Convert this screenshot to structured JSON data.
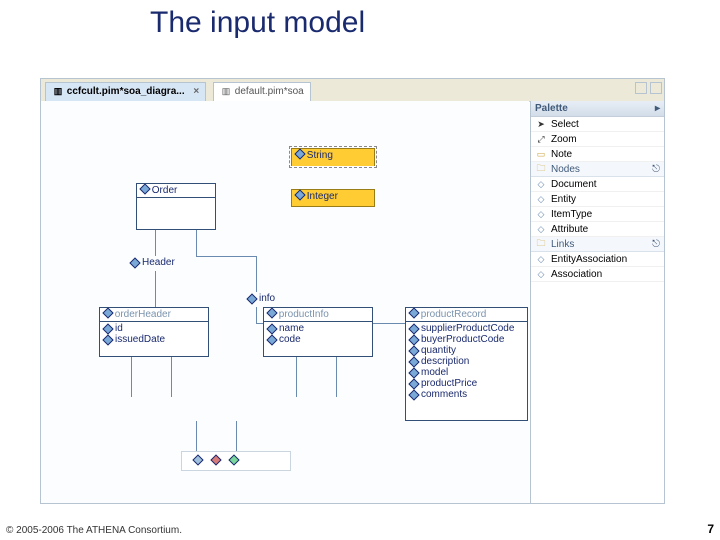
{
  "title": "The input model",
  "footer": "© 2005-2006 The ATHENA Consortium.",
  "page_number": "7",
  "tabs": {
    "active": "ccfcult.pim*soa_diagra...",
    "inactive": "default.pim*soa"
  },
  "palette": {
    "title": "Palette",
    "tools": {
      "select": "Select",
      "zoom": "Zoom",
      "note": "Note"
    },
    "groups": {
      "nodes": {
        "label": "Nodes",
        "items": {
          "document": "Document",
          "entity": "Entity",
          "itemtype": "ItemType",
          "attribute": "Attribute"
        }
      },
      "links": {
        "label": "Links",
        "items": {
          "entityassoc": "EntityAssociation",
          "association": "Association"
        }
      }
    }
  },
  "diagram": {
    "string_box": "String",
    "integer_box": "Integer",
    "order_box": "Order",
    "header_label": "Header",
    "info_label": "info",
    "order_header": {
      "title": "orderHeader",
      "rows": {
        "id": "id",
        "issuedDate": "issuedDate"
      }
    },
    "product_info": {
      "title": "productInfo",
      "rows": {
        "name": "name",
        "code": "code"
      }
    },
    "product_record": {
      "title": "productRecord",
      "rows": {
        "supplierProductCode": "supplierProductCode",
        "buyerProductCode": "buyerProductCode",
        "quantity": "quantity",
        "description": "description",
        "model": "model",
        "productPrice": "productPrice",
        "comments": "comments"
      }
    }
  }
}
